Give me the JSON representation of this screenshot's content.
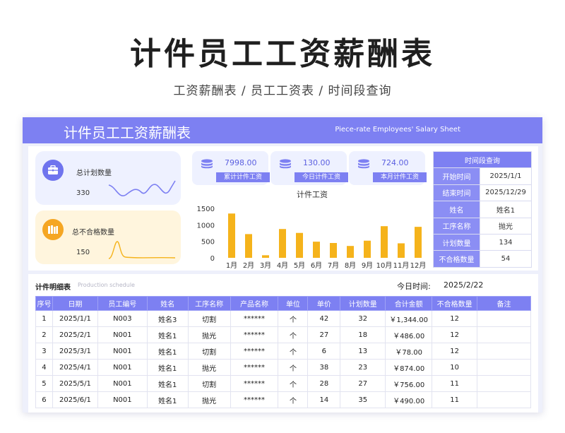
{
  "hero": {
    "title": "计件员工工资薪酬表",
    "subtitle": "工资薪酬表 / 员工工资表 / 时间段查询"
  },
  "banner": {
    "title": "计件员工工资薪酬表",
    "subtitle_en": "Piece-rate Employees' Salary Sheet"
  },
  "kpis": {
    "plan": {
      "label": "总计划数量",
      "value": "330",
      "icon": "briefcase-icon"
    },
    "defect": {
      "label": "总不合格数量",
      "value": "150",
      "icon": "books-icon"
    }
  },
  "stats": [
    {
      "value": "7998.00",
      "label": "累计计件工资",
      "icon": "coin-stack-icon"
    },
    {
      "value": "130.00",
      "label": "今日计件工资",
      "icon": "coin-stack-icon"
    },
    {
      "value": "724.00",
      "label": "本月计件工资",
      "icon": "coin-stack-icon"
    }
  ],
  "query": {
    "header": "时间段查询",
    "rows": [
      {
        "key": "开始时间",
        "value": "2025/1/1"
      },
      {
        "key": "结束时间",
        "value": "2025/12/29"
      },
      {
        "key": "姓名",
        "value": "姓名1"
      },
      {
        "key": "工序名称",
        "value": "抛光"
      },
      {
        "key": "计划数量",
        "value": "134"
      },
      {
        "key": "不合格数量",
        "value": "54"
      }
    ]
  },
  "chart_data": {
    "type": "bar",
    "title": "计件工资",
    "categories": [
      "1月",
      "2月",
      "3月",
      "4月",
      "5月",
      "6月",
      "7月",
      "8月",
      "9月",
      "10月",
      "11月",
      "12月"
    ],
    "values": [
      1344,
      720,
      78,
      874,
      756,
      490,
      450,
      360,
      520,
      960,
      440,
      940
    ],
    "ylim": [
      0,
      1500
    ],
    "yticks": [
      0,
      500,
      1000,
      1500
    ],
    "color": "#f5b31b",
    "grid": false
  },
  "detail": {
    "title": "计件明细表",
    "title_en": "Production schedule",
    "today_label": "今日时间:",
    "today_value": "2025/2/22",
    "columns": [
      "序号",
      "日期",
      "员工编号",
      "姓名",
      "工序名称",
      "产品名称",
      "单位",
      "单价",
      "计划数量",
      "合计金额",
      "不合格数量",
      "备注"
    ],
    "rows": [
      [
        "1",
        "2025/1/1",
        "N003",
        "姓名3",
        "切割",
        "******",
        "个",
        "42",
        "32",
        "￥1,344.00",
        "12",
        ""
      ],
      [
        "2",
        "2025/2/1",
        "N001",
        "姓名1",
        "抛光",
        "******",
        "个",
        "27",
        "18",
        "￥486.00",
        "12",
        ""
      ],
      [
        "3",
        "2025/3/1",
        "N001",
        "姓名1",
        "切割",
        "******",
        "个",
        "6",
        "13",
        "￥78.00",
        "12",
        ""
      ],
      [
        "4",
        "2025/4/1",
        "N001",
        "姓名1",
        "抛光",
        "******",
        "个",
        "38",
        "23",
        "￥874.00",
        "10",
        ""
      ],
      [
        "5",
        "2025/5/1",
        "N001",
        "姓名1",
        "切割",
        "******",
        "个",
        "28",
        "27",
        "￥756.00",
        "11",
        ""
      ],
      [
        "6",
        "2025/6/1",
        "N001",
        "姓名1",
        "抛光",
        "******",
        "个",
        "14",
        "35",
        "￥490.00",
        "11",
        ""
      ]
    ]
  },
  "colors": {
    "accent": "#7d80f2",
    "bar": "#f5b31b",
    "kpi_plan_bg": "#eef1ff",
    "kpi_defect_bg": "#fff5dd"
  }
}
